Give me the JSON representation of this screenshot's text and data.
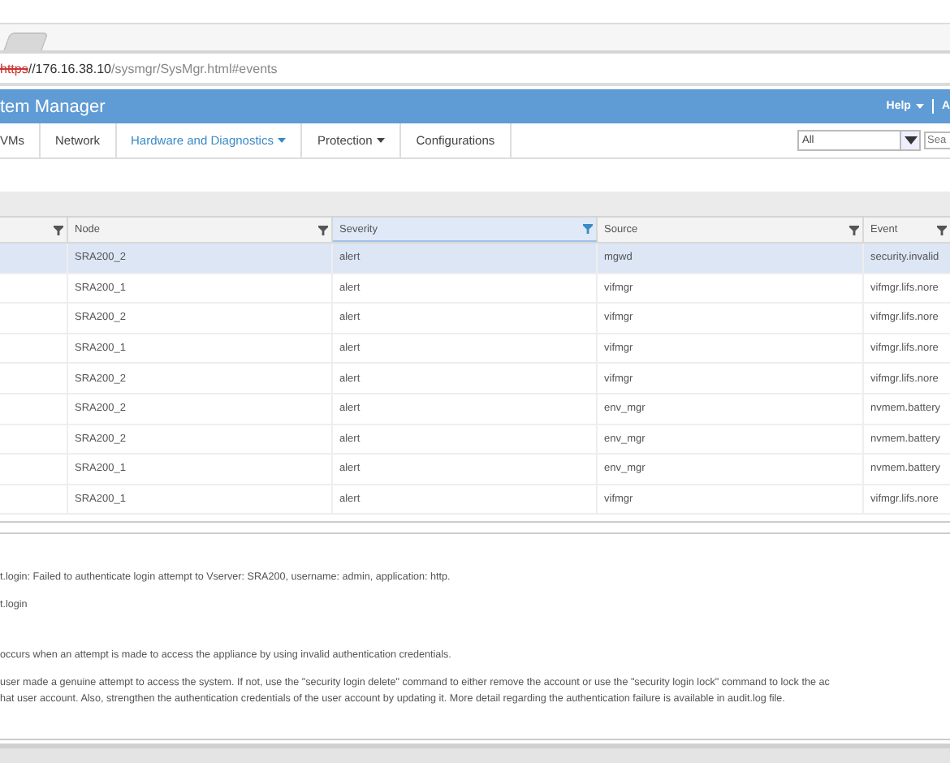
{
  "browser": {
    "url_scheme": "https",
    "url_host": "//176.16.38.10",
    "url_path": "/sysmgr/SysMgr.html#events"
  },
  "header": {
    "title": "tem Manager",
    "links": [
      {
        "label": "Help",
        "dropdown": true
      },
      {
        "label": "A",
        "dropdown": false
      }
    ]
  },
  "nav": {
    "items": [
      {
        "label": "VMs",
        "dropdown": false,
        "selected": false
      },
      {
        "label": "Network",
        "dropdown": false,
        "selected": false
      },
      {
        "label": "Hardware and Diagnostics",
        "dropdown": true,
        "selected": true
      },
      {
        "label": "Protection",
        "dropdown": true,
        "selected": false
      },
      {
        "label": "Configurations",
        "dropdown": false,
        "selected": false
      }
    ],
    "filter_select": {
      "value": "All"
    },
    "search": {
      "placeholder": "Sea"
    }
  },
  "table": {
    "columns": [
      {
        "active": false
      },
      {
        "label": "Node",
        "active": false
      },
      {
        "label": "Severity",
        "active": true
      },
      {
        "label": "Source",
        "active": false
      },
      {
        "label": "Event",
        "active": false
      }
    ],
    "rows": [
      {
        "selected": true,
        "node": "SRA200_2",
        "severity": "alert",
        "source": "mgwd",
        "event": "security.invalid"
      },
      {
        "selected": false,
        "node": "SRA200_1",
        "severity": "alert",
        "source": "vifmgr",
        "event": "vifmgr.lifs.nore"
      },
      {
        "selected": false,
        "node": "SRA200_2",
        "severity": "alert",
        "source": "vifmgr",
        "event": "vifmgr.lifs.nore"
      },
      {
        "selected": false,
        "node": "SRA200_1",
        "severity": "alert",
        "source": "vifmgr",
        "event": "vifmgr.lifs.nore"
      },
      {
        "selected": false,
        "node": "SRA200_2",
        "severity": "alert",
        "source": "vifmgr",
        "event": "vifmgr.lifs.nore"
      },
      {
        "selected": false,
        "node": "SRA200_2",
        "severity": "alert",
        "source": "env_mgr",
        "event": "nvmem.battery"
      },
      {
        "selected": false,
        "node": "SRA200_2",
        "severity": "alert",
        "source": "env_mgr",
        "event": "nvmem.battery"
      },
      {
        "selected": false,
        "node": "SRA200_1",
        "severity": "alert",
        "source": "env_mgr",
        "event": "nvmem.battery"
      },
      {
        "selected": false,
        "node": "SRA200_1",
        "severity": "alert",
        "source": "vifmgr",
        "event": "vifmgr.lifs.nore"
      }
    ]
  },
  "details": {
    "message": "t.login: Failed to authenticate login attempt to Vserver: SRA200, username: admin, application: http.",
    "event_name": "t.login",
    "description": "occurs when an attempt is made to access the appliance by using invalid authentication credentials.",
    "action_lines": [
      "user made a genuine attempt to access the system. If not, use the \"security login delete\" command to either remove the account or use the \"security login lock\" command to lock the ac",
      "hat user account. Also, strengthen the authentication credentials of the user account by updating it. More detail regarding the authentication failure is available in audit.log file."
    ]
  }
}
